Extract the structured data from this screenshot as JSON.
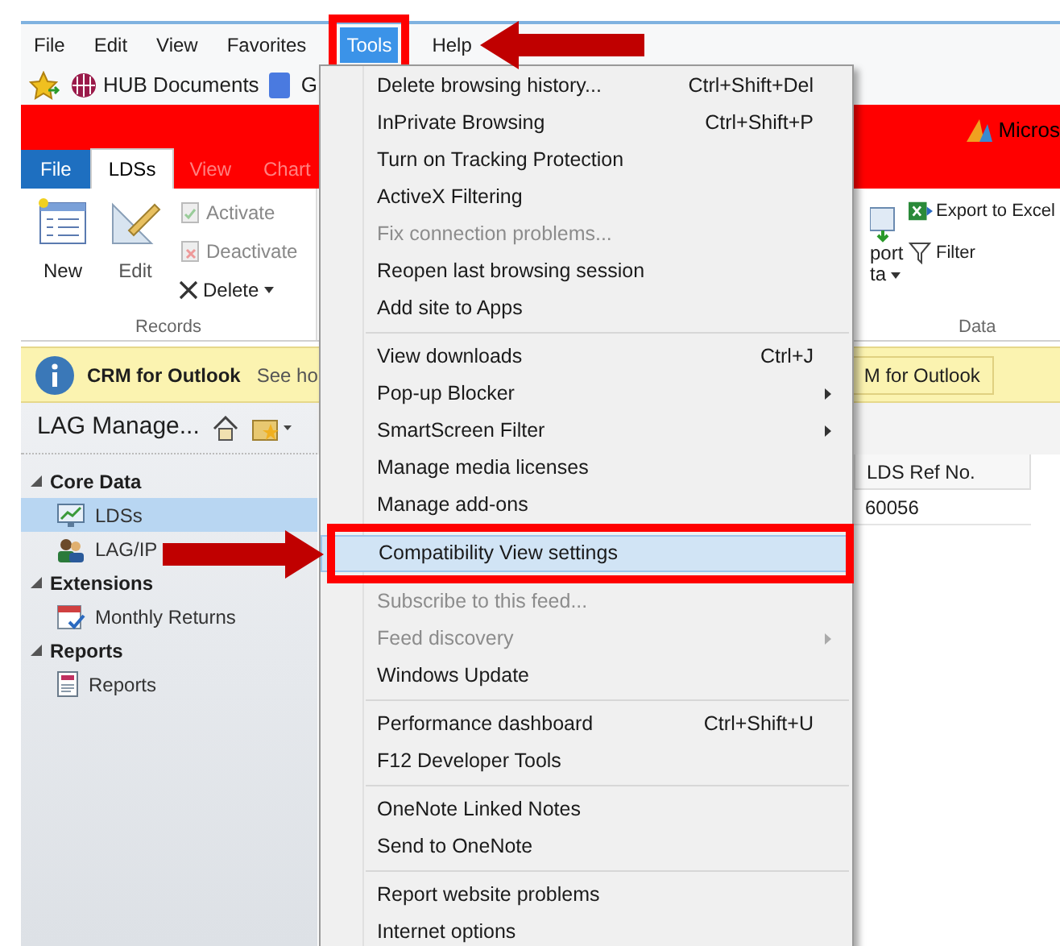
{
  "menu_bar": [
    {
      "label": "File",
      "selected": false
    },
    {
      "label": "Edit",
      "selected": false
    },
    {
      "label": "View",
      "selected": false
    },
    {
      "label": "Favorites",
      "selected": false
    },
    {
      "label": "Tools",
      "selected": true
    },
    {
      "label": "Help",
      "selected": false
    }
  ],
  "bookmarks": [
    {
      "label": "HUB Documents",
      "kind": "hub"
    },
    {
      "label": "G",
      "kind": "google"
    }
  ],
  "banner": {
    "brand": "Micros"
  },
  "ribbon": {
    "tabs": [
      {
        "label": "File",
        "kind": "file",
        "selected": false
      },
      {
        "label": "LDSs",
        "kind": "tab",
        "selected": true
      },
      {
        "label": "View",
        "kind": "tab",
        "selected": false
      },
      {
        "label": "Chart",
        "kind": "tab",
        "selected": false
      }
    ],
    "records": {
      "label": "Records",
      "new": "New",
      "edit": "Edit",
      "activate": "Activate",
      "deactivate": "Deactivate",
      "delete": "Delete"
    },
    "data": {
      "label": "Data",
      "export_data": [
        "port",
        "ta"
      ],
      "export_excel": "Export to Excel",
      "filter": "Filter"
    }
  },
  "notification": {
    "title": "CRM for Outlook",
    "text": "See ho",
    "button": "M for Outlook"
  },
  "nav": {
    "title": "LAG Manage...",
    "sections": [
      {
        "title": "Core Data",
        "expanded": true,
        "items": [
          {
            "label": "LDSs",
            "kind": "chart",
            "selected": true
          },
          {
            "label": "LAG/IP",
            "kind": "people",
            "selected": false
          }
        ]
      },
      {
        "title": "Extensions",
        "expanded": true,
        "items": [
          {
            "label": "Monthly Returns",
            "kind": "calendar",
            "selected": false
          }
        ]
      },
      {
        "title": "Reports",
        "expanded": true,
        "items": [
          {
            "label": "Reports",
            "kind": "report",
            "selected": false
          }
        ]
      }
    ]
  },
  "grid": {
    "columns": [
      "LDS Ref No."
    ],
    "rows": [
      [
        "60056"
      ]
    ]
  },
  "tools_menu": [
    {
      "kind": "item",
      "label": "Delete browsing history...",
      "shortcut": "Ctrl+Shift+Del",
      "disabled": false,
      "submenu": false,
      "selected": false
    },
    {
      "kind": "item",
      "label": "InPrivate Browsing",
      "shortcut": "Ctrl+Shift+P",
      "disabled": false,
      "submenu": false,
      "selected": false
    },
    {
      "kind": "item",
      "label": "Turn on Tracking Protection",
      "disabled": false,
      "submenu": false,
      "selected": false
    },
    {
      "kind": "item",
      "label": "ActiveX Filtering",
      "disabled": false,
      "submenu": false,
      "selected": false
    },
    {
      "kind": "item",
      "label": "Fix connection problems...",
      "disabled": true,
      "submenu": false,
      "selected": false
    },
    {
      "kind": "item",
      "label": "Reopen last browsing session",
      "disabled": false,
      "submenu": false,
      "selected": false
    },
    {
      "kind": "item",
      "label": "Add site to Apps",
      "disabled": false,
      "submenu": false,
      "selected": false
    },
    {
      "kind": "separator"
    },
    {
      "kind": "item",
      "label": "View downloads",
      "shortcut": "Ctrl+J",
      "disabled": false,
      "submenu": false,
      "selected": false
    },
    {
      "kind": "item",
      "label": "Pop-up Blocker",
      "disabled": false,
      "submenu": true,
      "selected": false
    },
    {
      "kind": "item",
      "label": "SmartScreen Filter",
      "disabled": false,
      "submenu": true,
      "selected": false
    },
    {
      "kind": "item",
      "label": "Manage media licenses",
      "disabled": false,
      "submenu": false,
      "selected": false
    },
    {
      "kind": "item",
      "label": "Manage add-ons",
      "disabled": false,
      "submenu": false,
      "selected": false
    },
    {
      "kind": "separator"
    },
    {
      "kind": "item",
      "label": "Compatibility View settings",
      "disabled": false,
      "submenu": false,
      "selected": true
    },
    {
      "kind": "separator"
    },
    {
      "kind": "item",
      "label": "Subscribe to this feed...",
      "disabled": true,
      "submenu": false,
      "selected": false
    },
    {
      "kind": "item",
      "label": "Feed discovery",
      "disabled": true,
      "submenu": true,
      "selected": false
    },
    {
      "kind": "item",
      "label": "Windows Update",
      "disabled": false,
      "submenu": false,
      "selected": false
    },
    {
      "kind": "separator"
    },
    {
      "kind": "item",
      "label": "Performance dashboard",
      "shortcut": "Ctrl+Shift+U",
      "disabled": false,
      "submenu": false,
      "selected": false
    },
    {
      "kind": "item",
      "label": "F12 Developer Tools",
      "disabled": false,
      "submenu": false,
      "selected": false
    },
    {
      "kind": "separator"
    },
    {
      "kind": "item",
      "label": "OneNote Linked Notes",
      "disabled": false,
      "submenu": false,
      "selected": false
    },
    {
      "kind": "item",
      "label": "Send to OneNote",
      "disabled": false,
      "submenu": false,
      "selected": false
    },
    {
      "kind": "separator"
    },
    {
      "kind": "item",
      "label": "Report website problems",
      "disabled": false,
      "submenu": false,
      "selected": false
    },
    {
      "kind": "item",
      "label": "Internet options",
      "disabled": false,
      "submenu": false,
      "selected": false
    }
  ]
}
